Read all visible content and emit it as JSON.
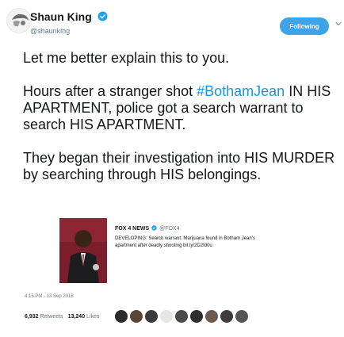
{
  "author": {
    "display_name": "Shaun King",
    "handle": "@shaunking",
    "verified_icon": "verified-badge-icon",
    "avatar_icon": "profile-avatar"
  },
  "follow_button": {
    "label": "Following",
    "color": "#3fa3e8"
  },
  "tweet": {
    "paragraph1": "Let me better explain this to you.",
    "p2_before": "Hours after a stranger shot ",
    "p2_hashtag": "#BothamJean",
    "p2_after": " IN HIS APARTMENT, police got a search warrant to search HIS APARTMENT.",
    "paragraph3": "They began their investigation into HIS MURDER by searching through HIS belongings."
  },
  "quoted_card": {
    "source_name": "FOX 4 NEWS",
    "source_handle": "@FOX4",
    "text": "DEVELOPING: Search warrant: Marijuana found in Botham Jean's apartment after deadly shooting bit.ly/2D2fd0u"
  },
  "timestamp": "4:15 PM - 13 Sep 2018",
  "stats": {
    "retweets_count": "6,932",
    "retweets_label": "Retweets",
    "likes_count": "13,240",
    "likes_label": "Likes"
  },
  "liker_avatar_colors": [
    "#2b2b2b",
    "#5a4636",
    "#3a3a3a",
    "#e9e5e0",
    "#4a4a4a",
    "#2e2e2e",
    "#6b5a4d",
    "#3d3d3d",
    "#565656"
  ],
  "hashtag_color": "#1b95e0"
}
